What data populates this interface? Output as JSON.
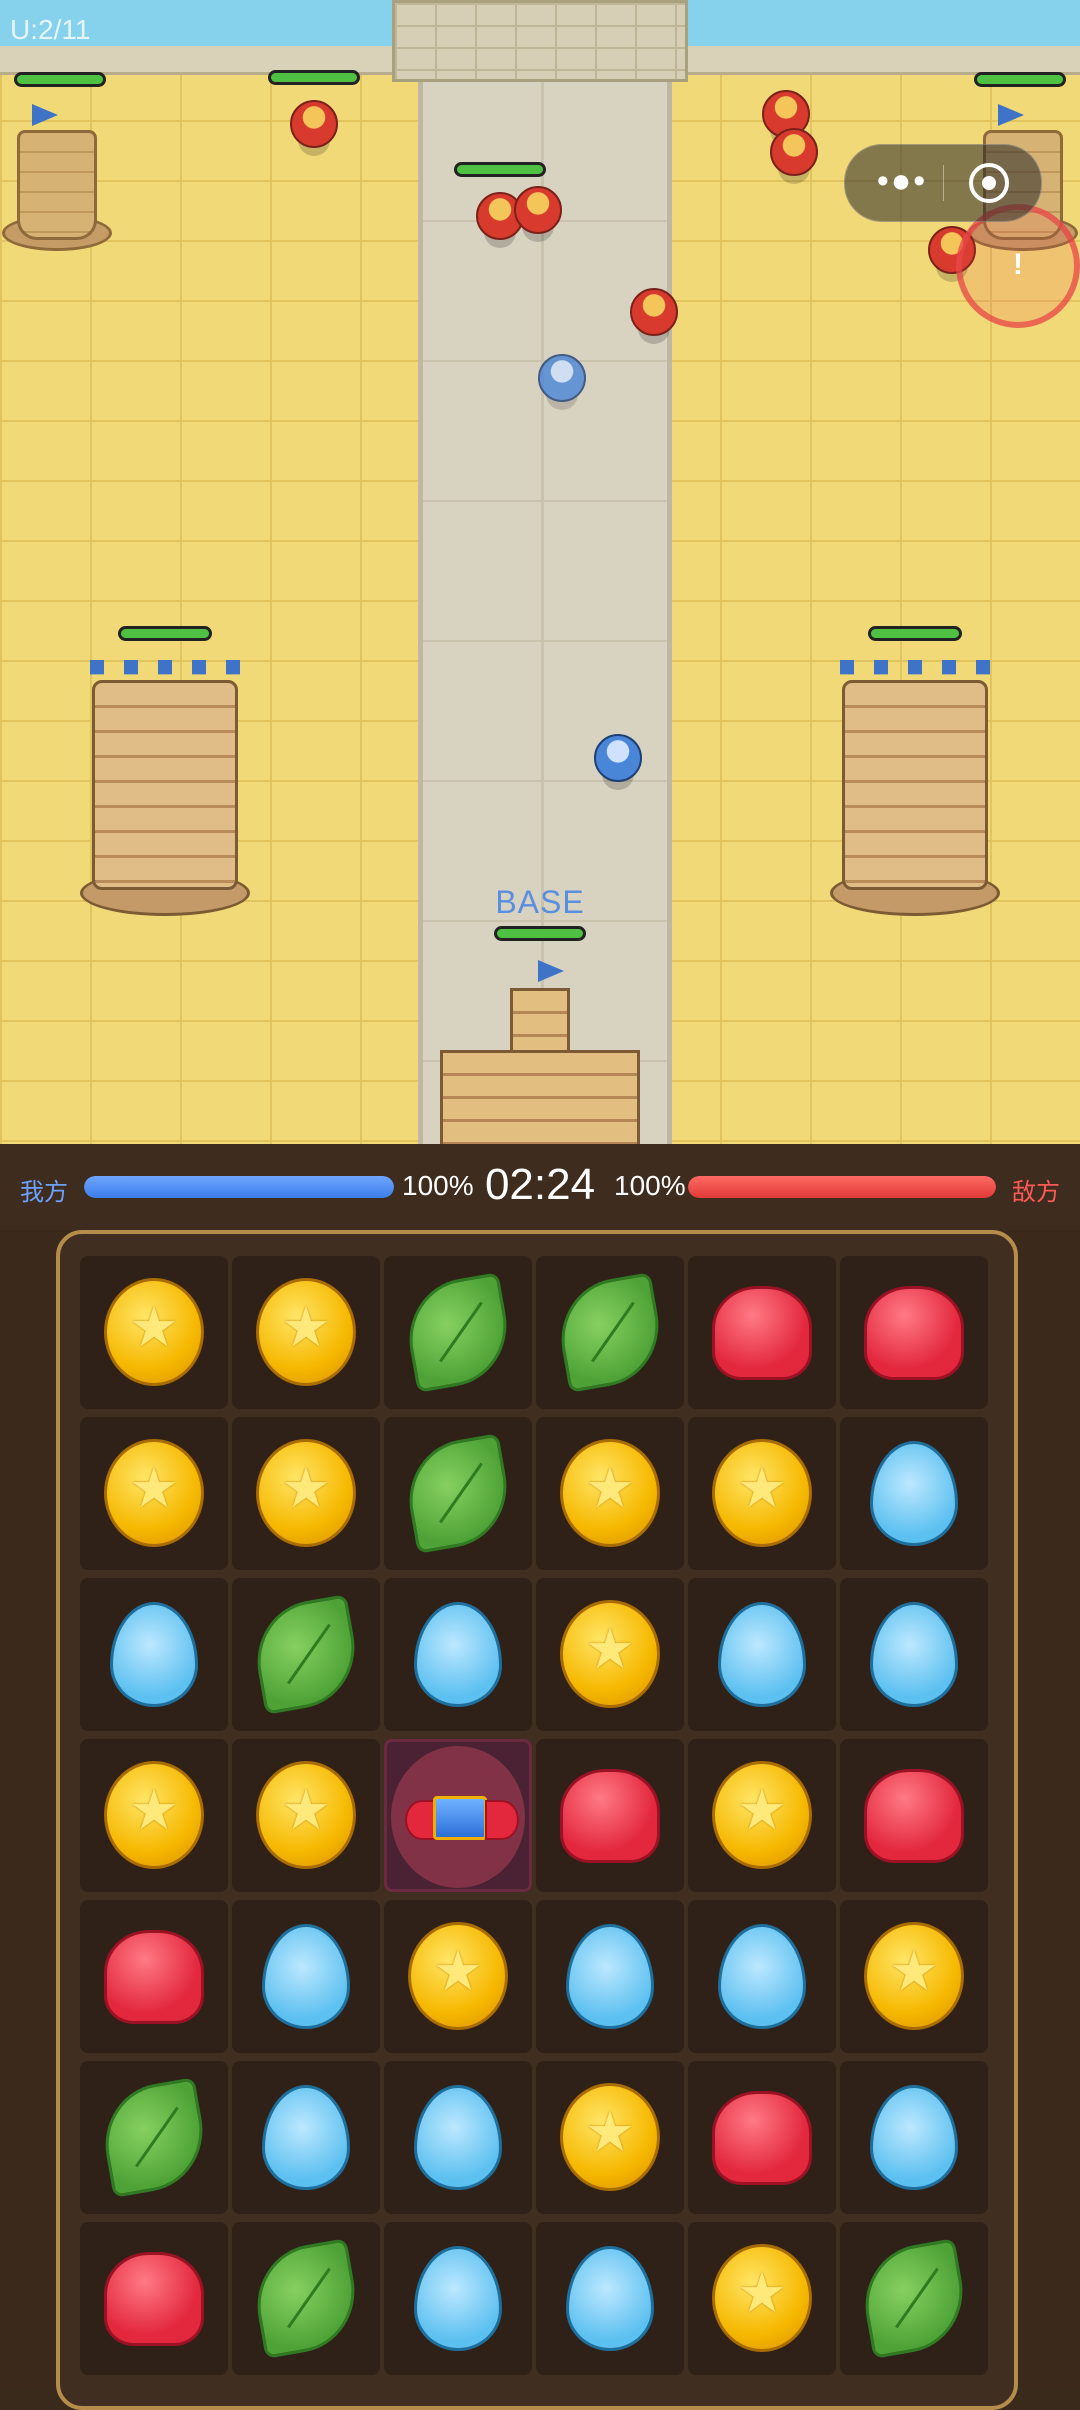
{
  "debug": {
    "unit_counter": "U:2/11"
  },
  "battlefield": {
    "base_label": "BASE",
    "alert_marker": "!"
  },
  "mini_program_capsule": {
    "more_label": "•●•"
  },
  "status_bar": {
    "ally_label": "我方",
    "ally_hp": "100%",
    "ally_hp_fraction": 1.0,
    "timer": "02:24",
    "enemy_hp": "100%",
    "enemy_hp_fraction": 1.0,
    "enemy_label": "敌方"
  },
  "board": {
    "rows": [
      [
        "coin",
        "coin",
        "leaf",
        "leaf",
        "jelly",
        "jelly"
      ],
      [
        "coin",
        "coin",
        "leaf",
        "coin",
        "coin",
        "drop"
      ],
      [
        "drop",
        "leaf",
        "drop",
        "coin",
        "drop",
        "drop"
      ],
      [
        "coin",
        "coin",
        "rocket",
        "jelly",
        "coin",
        "jelly"
      ],
      [
        "jelly",
        "drop",
        "coin",
        "drop",
        "drop",
        "coin"
      ],
      [
        "leaf",
        "drop",
        "drop",
        "coin",
        "jelly",
        "drop"
      ],
      [
        "jelly",
        "leaf",
        "drop",
        "drop",
        "coin",
        "leaf"
      ]
    ],
    "selected": {
      "row": 3,
      "col": 2
    }
  },
  "colors": {
    "ally": "#3c7de8",
    "enemy": "#e03a36",
    "board_frame": "#b58c4a"
  }
}
